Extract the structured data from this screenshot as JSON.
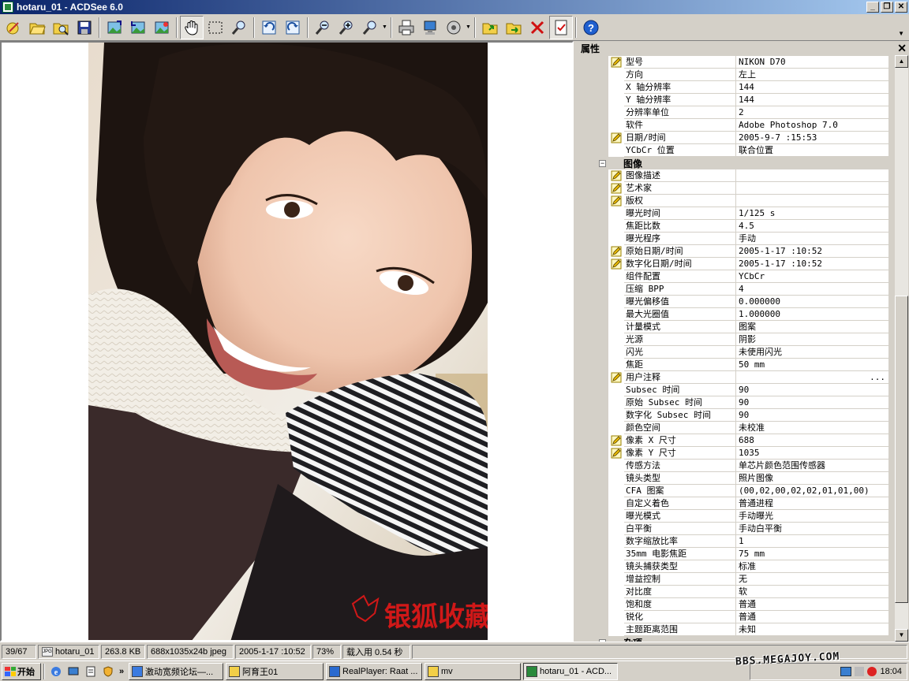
{
  "window": {
    "title": "hotaru_01 - ACDSee 6.0"
  },
  "toolbar": {
    "icons": [
      "acquire-icon",
      "open-icon",
      "browse-icon",
      "save-icon",
      "prev-image-icon",
      "next-image-icon",
      "auto-advance-icon",
      "hand-tool-icon",
      "select-tool-icon",
      "zoom-tool-icon",
      "rotate-left-icon",
      "rotate-right-icon",
      "zoom-out-icon",
      "zoom-in-icon",
      "zoom-menu-icon",
      "print-icon",
      "set-wallpaper-icon",
      "audio-icon",
      "copy-to-icon",
      "move-to-icon",
      "delete-icon",
      "properties-icon",
      "help-icon"
    ]
  },
  "viewer": {
    "watermark_text": "银狐收藏"
  },
  "properties": {
    "title": "属性",
    "close": "✕",
    "rows": [
      {
        "type": "row",
        "edit": true,
        "k": "型号",
        "v": "NIKON D70"
      },
      {
        "type": "row",
        "edit": false,
        "k": "方向",
        "v": "左上"
      },
      {
        "type": "row",
        "edit": false,
        "k": "X 轴分辨率",
        "v": "144"
      },
      {
        "type": "row",
        "edit": false,
        "k": "Y 轴分辨率",
        "v": "144"
      },
      {
        "type": "row",
        "edit": false,
        "k": "分辨率单位",
        "v": "2"
      },
      {
        "type": "row",
        "edit": false,
        "k": "软件",
        "v": "Adobe Photoshop 7.0"
      },
      {
        "type": "row",
        "edit": true,
        "k": "日期/时间",
        "v": "2005-9-7 :15:53"
      },
      {
        "type": "row",
        "edit": false,
        "k": "YCbCr 位置",
        "v": "联合位置"
      },
      {
        "type": "cat",
        "toggle": "−",
        "k": "图像"
      },
      {
        "type": "row",
        "edit": true,
        "k": "图像描述",
        "v": ""
      },
      {
        "type": "row",
        "edit": true,
        "k": "艺术家",
        "v": ""
      },
      {
        "type": "row",
        "edit": true,
        "k": "版权",
        "v": ""
      },
      {
        "type": "row",
        "edit": false,
        "k": "曝光时间",
        "v": "1/125 s"
      },
      {
        "type": "row",
        "edit": false,
        "k": "焦距比数",
        "v": "4.5"
      },
      {
        "type": "row",
        "edit": false,
        "k": "曝光程序",
        "v": "手动"
      },
      {
        "type": "row",
        "edit": true,
        "k": "原始日期/时间",
        "v": "2005-1-17 :10:52"
      },
      {
        "type": "row",
        "edit": true,
        "k": "数字化日期/时间",
        "v": "2005-1-17 :10:52"
      },
      {
        "type": "row",
        "edit": false,
        "k": "组件配置",
        "v": "YCbCr"
      },
      {
        "type": "row",
        "edit": false,
        "k": "压缩 BPP",
        "v": "4"
      },
      {
        "type": "row",
        "edit": false,
        "k": "曝光偏移值",
        "v": "0.000000"
      },
      {
        "type": "row",
        "edit": false,
        "k": "最大光圈值",
        "v": "1.000000"
      },
      {
        "type": "row",
        "edit": false,
        "k": "计量模式",
        "v": "图案"
      },
      {
        "type": "row",
        "edit": false,
        "k": "光源",
        "v": "阴影"
      },
      {
        "type": "row",
        "edit": false,
        "k": "闪光",
        "v": "未使用闪光"
      },
      {
        "type": "row",
        "edit": false,
        "k": "焦距",
        "v": "50 mm"
      },
      {
        "type": "row",
        "edit": true,
        "k": "用户注释",
        "v": "",
        "dots": "..."
      },
      {
        "type": "row",
        "edit": false,
        "k": "Subsec 时间",
        "v": "90"
      },
      {
        "type": "row",
        "edit": false,
        "k": "原始 Subsec 时间",
        "v": "90"
      },
      {
        "type": "row",
        "edit": false,
        "k": "数字化 Subsec 时间",
        "v": "90"
      },
      {
        "type": "row",
        "edit": false,
        "k": "颜色空间",
        "v": "未校准"
      },
      {
        "type": "row",
        "edit": true,
        "k": "像素 X 尺寸",
        "v": "688"
      },
      {
        "type": "row",
        "edit": true,
        "k": "像素 Y 尺寸",
        "v": "1035"
      },
      {
        "type": "row",
        "edit": false,
        "k": "传感方法",
        "v": "单芯片颜色范围传感器"
      },
      {
        "type": "row",
        "edit": false,
        "k": "镜头类型",
        "v": "照片图像"
      },
      {
        "type": "row",
        "edit": false,
        "k": "CFA 图案",
        "v": "(00,02,00,02,02,01,01,00)"
      },
      {
        "type": "row",
        "edit": false,
        "k": "自定义着色",
        "v": "普通进程"
      },
      {
        "type": "row",
        "edit": false,
        "k": "曝光模式",
        "v": "手动曝光"
      },
      {
        "type": "row",
        "edit": false,
        "k": "白平衡",
        "v": "手动白平衡"
      },
      {
        "type": "row",
        "edit": false,
        "k": "数字缩放比率",
        "v": "1"
      },
      {
        "type": "row",
        "edit": false,
        "k": "35mm 电影焦距",
        "v": "75 mm"
      },
      {
        "type": "row",
        "edit": false,
        "k": "镜头捕获类型",
        "v": "标准"
      },
      {
        "type": "row",
        "edit": false,
        "k": "增益控制",
        "v": "无"
      },
      {
        "type": "row",
        "edit": false,
        "k": "对比度",
        "v": "软"
      },
      {
        "type": "row",
        "edit": false,
        "k": "饱和度",
        "v": "普通"
      },
      {
        "type": "row",
        "edit": false,
        "k": "锐化",
        "v": "普通"
      },
      {
        "type": "row",
        "edit": false,
        "k": "主题距离范围",
        "v": "未知"
      },
      {
        "type": "cat",
        "toggle": "−",
        "k": "杂项"
      }
    ]
  },
  "statusbar": {
    "index": "39/67",
    "filename": "hotaru_01",
    "size": "263.8 KB",
    "dims": "688x1035x24b jpeg",
    "date": "2005-1-17 :10:52",
    "zoom": "73%",
    "load": "载入用 0.54 秒"
  },
  "taskbar": {
    "start": "开始",
    "tasks": [
      {
        "label": "激动宽频论坛—...",
        "icon": "ie-icon"
      },
      {
        "label": "阿育王01",
        "icon": "folder-icon"
      },
      {
        "label": "RealPlayer: Raat ...",
        "icon": "realplayer-icon"
      },
      {
        "label": "mv",
        "icon": "folder-icon"
      },
      {
        "label": "hotaru_01 - ACD...",
        "icon": "acdsee-icon",
        "active": true
      }
    ],
    "clock": "18:04"
  },
  "overlay_watermark": "BBS.MEGAJOY.COM"
}
